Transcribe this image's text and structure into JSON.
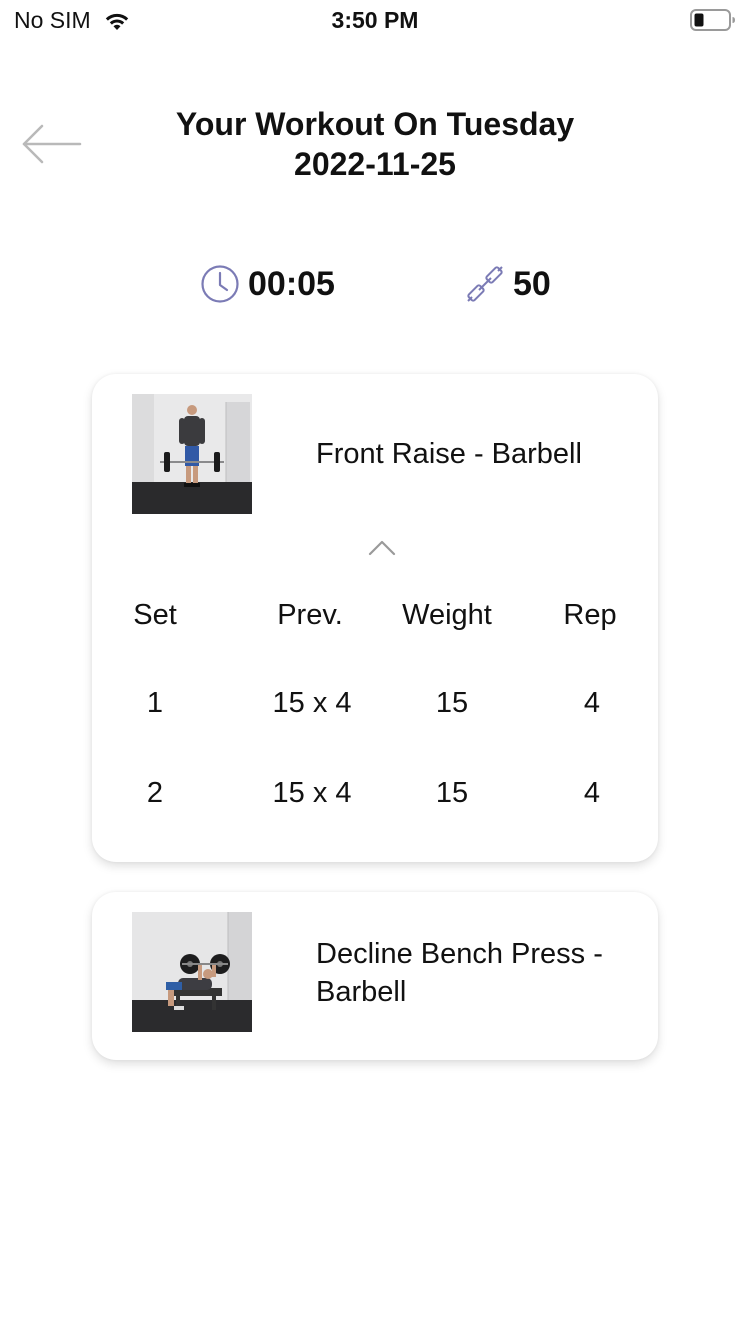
{
  "status_bar": {
    "carrier": "No SIM",
    "time": "3:50 PM",
    "icons": [
      "wifi-icon",
      "battery-icon"
    ]
  },
  "header": {
    "back_icon": "back-arrow-icon",
    "title_line1": "Your Workout On Tuesday",
    "title_line2": "2022-11-25"
  },
  "stats": {
    "duration": "00:05",
    "duration_icon": "clock-icon",
    "volume": "50",
    "volume_icon": "dumbbell-icon",
    "accent_color": "#7b7bb5"
  },
  "exercises": [
    {
      "name": "Front Raise - Barbell",
      "thumbnail": "front-raise-barbell-photo",
      "expanded": true,
      "toggle_icon": "chevron-up-icon",
      "columns": [
        "Set",
        "Prev.",
        "Weight",
        "Rep"
      ],
      "sets": [
        {
          "set": "1",
          "prev": "15 x 4",
          "weight": "15",
          "rep": "4"
        },
        {
          "set": "2",
          "prev": "15 x 4",
          "weight": "15",
          "rep": "4"
        }
      ]
    },
    {
      "name": "Decline Bench Press - Barbell",
      "thumbnail": "decline-bench-press-barbell-photo",
      "expanded": false
    }
  ]
}
